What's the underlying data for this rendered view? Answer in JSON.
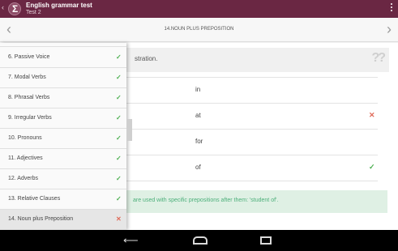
{
  "appbar": {
    "title": "English grammar test",
    "subtitle": "Test 2",
    "back_icon": "‹",
    "logo_glyph": "Σ"
  },
  "question": {
    "title": "14.NOUN PLUS PREPOSITION",
    "instruction": "stration."
  },
  "options": [
    {
      "text": "in",
      "mark": ""
    },
    {
      "text": "at",
      "mark": "✕"
    },
    {
      "text": "for",
      "mark": ""
    },
    {
      "text": "of",
      "mark": "✓"
    }
  ],
  "explanation": "are used with specific prepositions after them: 'student of'.",
  "drawer": {
    "items": [
      {
        "label": "6. Passive Voice",
        "mark": "✓"
      },
      {
        "label": "7. Modal Verbs",
        "mark": "✓"
      },
      {
        "label": "8. Phrasal Verbs",
        "mark": "✓"
      },
      {
        "label": "9. Irregular Verbs",
        "mark": "✓"
      },
      {
        "label": "10. Pronouns",
        "mark": "✓"
      },
      {
        "label": "11. Adjectives",
        "mark": "✓"
      },
      {
        "label": "12. Adverbs",
        "mark": "✓"
      },
      {
        "label": "13. Relative Clauses",
        "mark": "✓"
      },
      {
        "label": "14. Noun plus Preposition",
        "mark": "✕"
      }
    ]
  },
  "colors": {
    "appbar": "#6a2743",
    "correct": "#4caf50",
    "wrong": "#e06b5a",
    "explanation_bg": "#dff0e4"
  },
  "icons": {
    "nav_prev": "chevron-left-icon",
    "nav_next": "chevron-right-icon",
    "help": "question-marks-icon",
    "overflow": "overflow-menu-icon"
  }
}
